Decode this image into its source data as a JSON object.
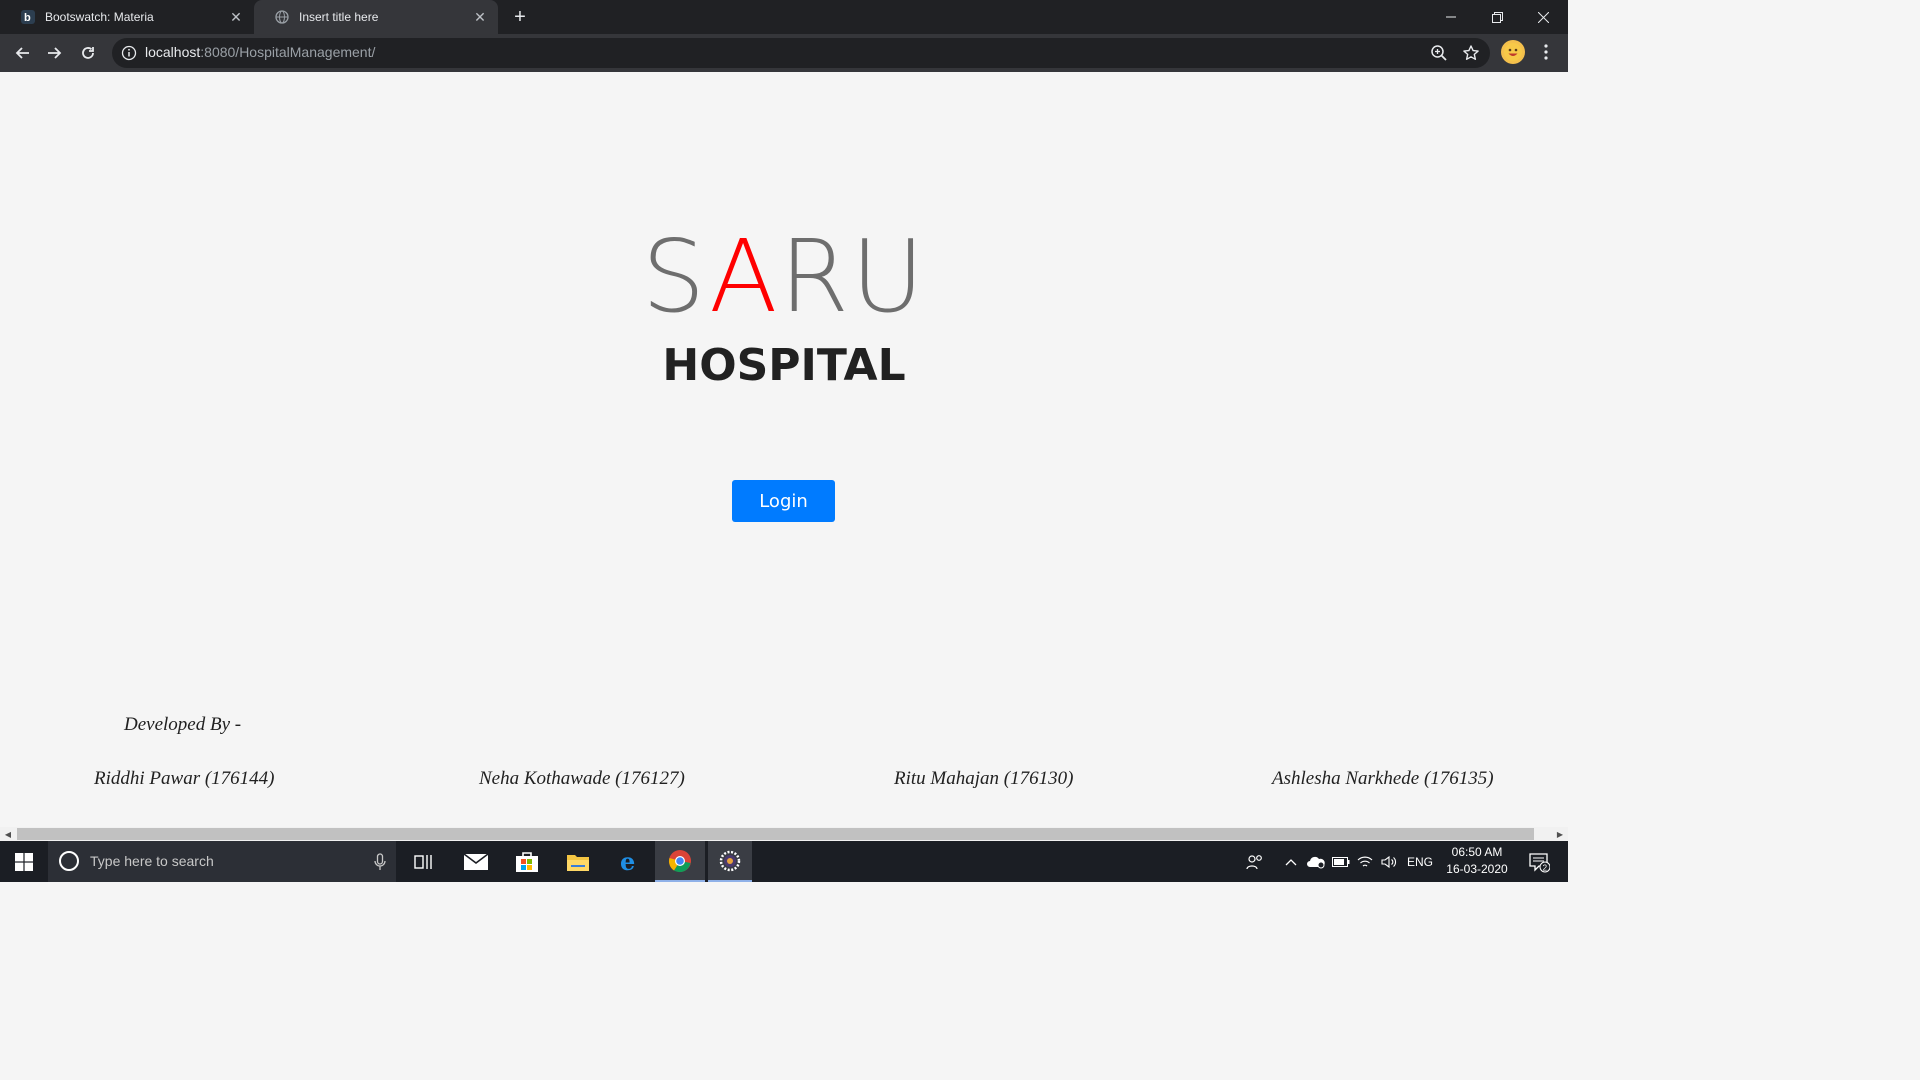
{
  "browser": {
    "tabs": [
      {
        "title": "Bootswatch: Materia",
        "favicon": "bootswatch-icon",
        "active": false
      },
      {
        "title": "Insert title here",
        "favicon": "globe-icon",
        "active": true
      }
    ],
    "url_host": "localhost",
    "url_path": ":8080/HospitalManagement/"
  },
  "page": {
    "brand": {
      "s": "S",
      "a": "A",
      "ru": "RU"
    },
    "subtitle": "HOSPITAL",
    "login_label": "Login",
    "developed_by": "Developed By -",
    "developers": [
      "Riddhi Pawar (176144)",
      "Neha Kothawade (176127)",
      "Ritu Mahajan (176130)",
      "Ashlesha Narkhede (176135)"
    ],
    "colors": {
      "accent_letter": "#ff0000",
      "login_button": "#007bff"
    }
  },
  "taskbar": {
    "search_placeholder": "Type here to search",
    "language": "ENG",
    "time": "06:50 AM",
    "date": "16-03-2020",
    "notification_count": "2"
  }
}
